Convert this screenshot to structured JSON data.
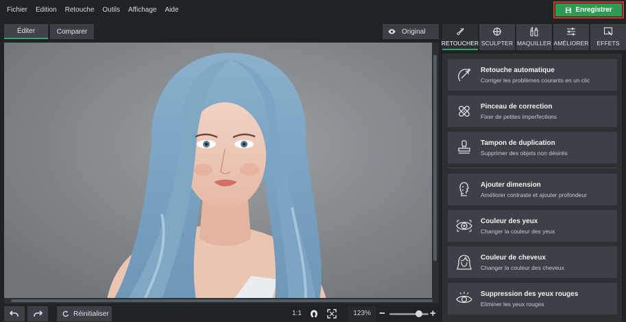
{
  "menu": {
    "items": [
      "Fichier",
      "Edition",
      "Retouche",
      "Outils",
      "Affichage",
      "Aide"
    ]
  },
  "save": {
    "label": "Enregistrer",
    "icon": "floppy-disk-icon",
    "color": "#2f9a52"
  },
  "view": {
    "tabs": [
      "Éditer",
      "Comparer"
    ],
    "active": "Éditer",
    "original_label": "Original"
  },
  "bottom": {
    "reset_label": "Réinitialiser",
    "ratio_label": "1:1",
    "zoom_label": "123%",
    "zoom_level": 0.75
  },
  "tools": {
    "tabs": [
      {
        "label": "RETOUCHER",
        "icon": "retouch-brush-icon",
        "active": true
      },
      {
        "label": "SCULPTER",
        "icon": "sculpt-target-icon",
        "active": false
      },
      {
        "label": "MAQUILLER",
        "icon": "makeup-icon",
        "active": false
      },
      {
        "label": "AMÉLIORER",
        "icon": "sliders-icon",
        "active": false
      },
      {
        "label": "EFFETS",
        "icon": "effects-wand-icon",
        "active": false
      }
    ],
    "cards": [
      {
        "title": "Retouche automatique",
        "sub": "Corriger les problèmes courants en un clic",
        "icon": "auto-retouch-icon"
      },
      {
        "title": "Pinceau de correction",
        "sub": "Fixer de petites imperfections",
        "icon": "bandage-icon"
      },
      {
        "title": "Tampon de duplication",
        "sub": "Supprimer des objets non désirés",
        "icon": "stamp-icon"
      },
      {
        "title": "Ajouter dimension",
        "sub": "Améliorer contraste et ajouter profondeur",
        "icon": "face-dimension-icon"
      },
      {
        "title": "Couleur des yeux",
        "sub": "Changer la couleur des yeux",
        "icon": "eye-color-icon"
      },
      {
        "title": "Couleur de cheveux",
        "sub": "Changer la couleur des cheveux",
        "icon": "hair-icon"
      },
      {
        "title": "Suppression des yeux rouges",
        "sub": "Eliminer les yeux rouges",
        "icon": "red-eye-icon"
      }
    ]
  }
}
